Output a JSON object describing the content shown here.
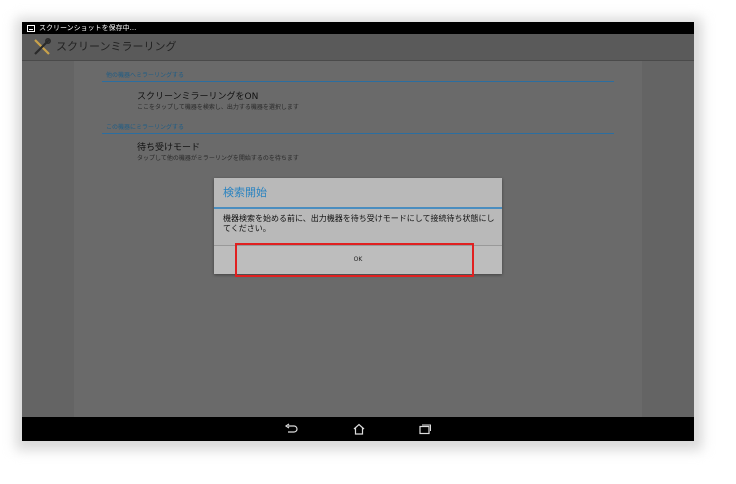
{
  "status_bar": {
    "icon": "screenshot-icon",
    "text": "スクリーンショットを保存中..."
  },
  "action_bar": {
    "icon": "tools-icon",
    "title": "スクリーンミラーリング"
  },
  "settings": {
    "section1_header": "他の機器へミラーリングする",
    "item1": {
      "title": "スクリーンミラーリングをON",
      "summary": "ここをタップして機器を検索し、出力する機器を選択します"
    },
    "section2_header": "この機器にミラーリングする",
    "item2": {
      "title": "待ち受けモード",
      "summary": "タップして他の機器がミラーリングを開始するのを待ちます"
    }
  },
  "dialog": {
    "title": "検索開始",
    "message": "機器検索を始める前に、出力機器を待ち受けモードにして接続待ち状態にしてください。",
    "ok_label": "OK"
  },
  "nav": {
    "back_icon": "back-icon",
    "home_icon": "home-icon",
    "recents_icon": "recents-icon"
  },
  "colors": {
    "highlight": "#e02020",
    "accent": "#2a83c0"
  }
}
